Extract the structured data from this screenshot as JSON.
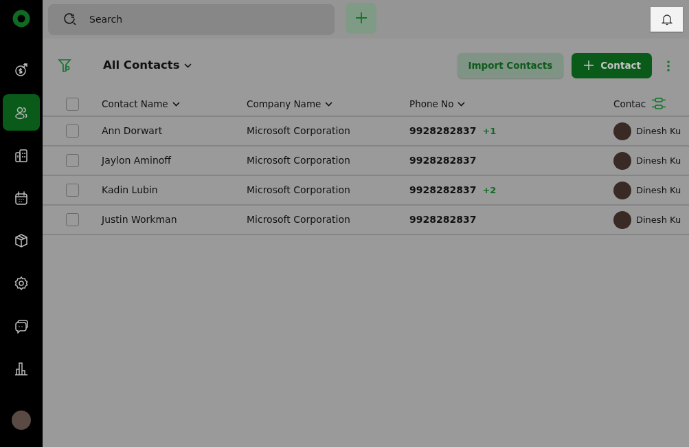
{
  "sidebar": {
    "items": [
      {
        "kind": "deals",
        "selected": false
      },
      {
        "kind": "contacts",
        "selected": true
      },
      {
        "kind": "companies",
        "selected": false
      },
      {
        "kind": "calendar",
        "selected": false
      },
      {
        "kind": "products",
        "selected": false
      },
      {
        "kind": "settings",
        "selected": false
      },
      {
        "kind": "chat",
        "selected": false
      },
      {
        "kind": "reports",
        "selected": false
      }
    ]
  },
  "search": {
    "placeholder": "Search"
  },
  "view": {
    "title": "All Contacts"
  },
  "buttons": {
    "import": "Import Contacts",
    "add": "Contact"
  },
  "table": {
    "select_all": {
      "checked": false
    },
    "columns": [
      {
        "label": "Contact Name",
        "sortable": true
      },
      {
        "label": "Company Name",
        "sortable": true
      },
      {
        "label": "Phone No",
        "sortable": true
      },
      {
        "label": "Contac",
        "sortable": false
      }
    ],
    "rows": [
      {
        "checked": false,
        "name": "Ann Dorwart",
        "company": "Microsoft Corporation",
        "phone": "9928282837",
        "extra": "+1",
        "owner": "Dinesh Ku"
      },
      {
        "checked": false,
        "name": "Jaylon Aminoff",
        "company": "Microsoft Corporation",
        "phone": "9928282837",
        "owner": "Dinesh Ku"
      },
      {
        "checked": false,
        "name": "Kadin Lubin",
        "company": "Microsoft Corporation",
        "phone": "9928282837",
        "extra": "+2",
        "owner": "Dinesh Ku"
      },
      {
        "checked": false,
        "name": "Justin Workman",
        "company": "Microsoft Corporation",
        "phone": "9928282837",
        "owner": "Dinesh Ku"
      }
    ]
  }
}
